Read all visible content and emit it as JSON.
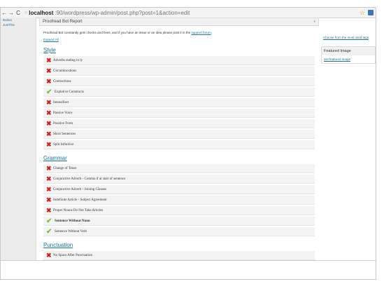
{
  "browser": {
    "url_host": "localhost",
    "url_rest": ":90/wordpress/wp-admin/post.php?post=1&action=edit"
  },
  "left_sidebar": {
    "items": [
      "Button",
      "JustThis"
    ]
  },
  "proofread_box": {
    "title": "Proofread Bot Report",
    "intro_text": "Proofread Bot constantly gets checks and fixes, and if you have an issue or an idea please post it in the",
    "intro_link": "support forum",
    "intro_end": ".",
    "expand_all": "Expand All"
  },
  "sections": {
    "style": {
      "title": "Style",
      "items": [
        {
          "label": "Adverbs ending in ly",
          "status": "fail"
        },
        {
          "label": "Circumlocutions",
          "status": "fail"
        },
        {
          "label": "Contractions",
          "status": "fail"
        },
        {
          "label": "Expletive Constructs",
          "status": "pass"
        },
        {
          "label": "Intensifiers",
          "status": "fail"
        },
        {
          "label": "Passive Voice",
          "status": "fail"
        },
        {
          "label": "Positive Form",
          "status": "fail"
        },
        {
          "label": "Short Sentences",
          "status": "fail"
        },
        {
          "label": "Split Infinitive",
          "status": "fail"
        }
      ]
    },
    "grammar": {
      "title": "Grammar",
      "items": [
        {
          "label": "Change of Tense",
          "status": "fail"
        },
        {
          "label": "Conjunctive Adverb - Comma if at start of sentence",
          "status": "fail"
        },
        {
          "label": "Conjunctive Adverb - Joining Clauses",
          "status": "fail"
        },
        {
          "label": "Indefinite Article - Subject Agreement",
          "status": "fail"
        },
        {
          "label": "Proper Nouns Do Not Take Articles",
          "status": "fail"
        },
        {
          "label": "Sentence Without Noun",
          "status": "pass"
        },
        {
          "label": "Sentence Without Verb",
          "status": "pass"
        }
      ]
    },
    "punctuation": {
      "title": "Punctuation",
      "items": [
        {
          "label": "No Space After Punctuation",
          "status": "fail"
        }
      ]
    }
  },
  "right_sidebar": {
    "tags_link": "Choose from the most used tags",
    "featured_image_title": "Featured Image",
    "set_featured_link": "Set featured image"
  },
  "colors": {
    "fail": "#cc2222",
    "pass": "#7fbd40",
    "link": "#21759b"
  },
  "icons": {
    "fail": "x-mark-icon",
    "pass": "checkmark-icon"
  }
}
